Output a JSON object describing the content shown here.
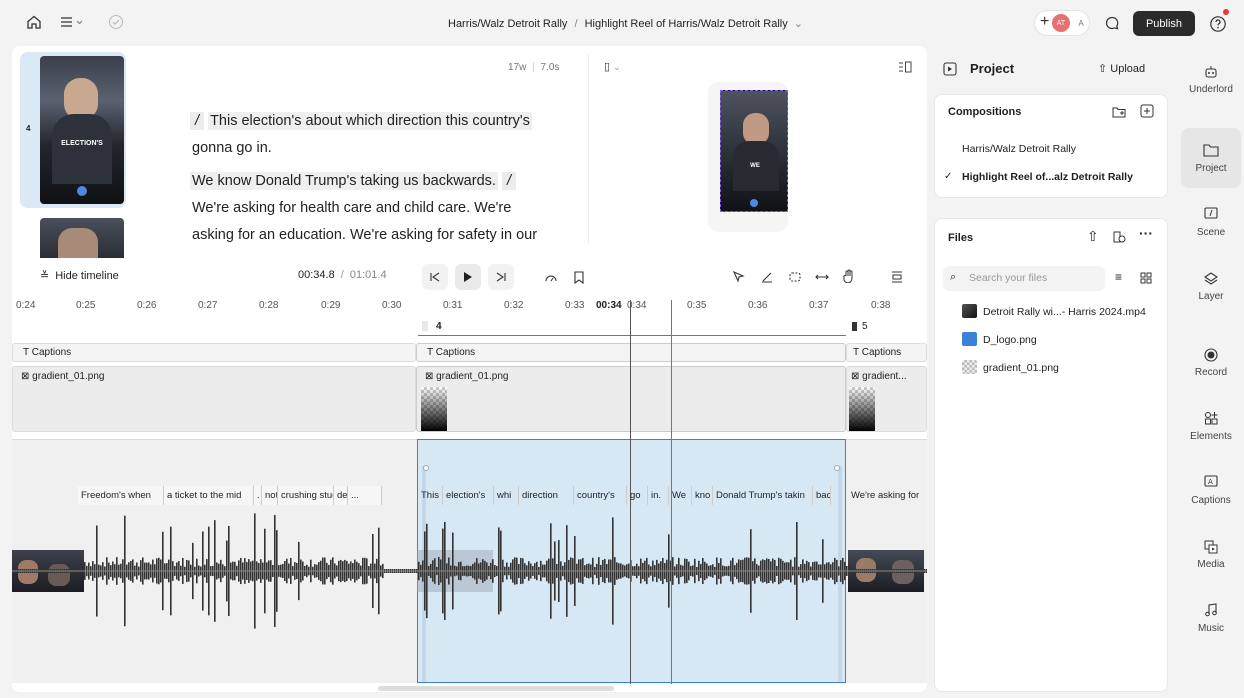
{
  "topbar": {
    "breadcrumb_project": "Harris/Walz Detroit Rally",
    "breadcrumb_sep": "/",
    "breadcrumb_comp": "Highlight Reel of Harris/Walz Detroit Rally",
    "avatar_initials": "AT",
    "avatar_a": "A",
    "publish_label": "Publish"
  },
  "script": {
    "word_count": "17w",
    "duration": "7.0s",
    "scene_number": "4",
    "thumb_caption": "ELECTION'S",
    "preview_caption": "WE",
    "paragraph1_marker": "/",
    "paragraph1_line1": "This election's about which direction this country's",
    "paragraph1_line2": "gonna go in.",
    "paragraph2_line1": "We know Donald Trump's taking us backwards.",
    "paragraph2_marker": "/",
    "paragraph2_line2": "We're asking for health care and child care. We're",
    "paragraph2_line3": "asking for an education. We're asking for safety in our"
  },
  "transport": {
    "hide_timeline": "Hide timeline",
    "current_time": "00:34.8",
    "separator": "/",
    "total_time": "01:01.4"
  },
  "timeline": {
    "ticks": [
      {
        "label": "0:24"
      },
      {
        "label": "0:25"
      },
      {
        "label": "0:26"
      },
      {
        "label": "0:27"
      },
      {
        "label": "0:28"
      },
      {
        "label": "0:29"
      },
      {
        "label": "0:30"
      },
      {
        "label": "0:31"
      },
      {
        "label": "0:32"
      },
      {
        "label": "0:33"
      },
      {
        "label": "0:34"
      },
      {
        "label": "0:35"
      },
      {
        "label": "0:36"
      },
      {
        "label": "0:37"
      },
      {
        "label": "0:38"
      }
    ],
    "playhead_label": "00:34",
    "scene4_label": "4",
    "scene5_label": "5",
    "captions_label": "Captions",
    "gradient_label": "gradient_01.png",
    "gradient_trunc": "gradient...",
    "words_left": [
      "Freedom's when",
      "a ticket to the mid",
      ".",
      "not",
      "crushing stud",
      "de",
      "..."
    ],
    "words_mid": [
      "This",
      "election's",
      "whi",
      "direction",
      "country's",
      "go",
      "in.",
      "We",
      "kno",
      "Donald Trump's takin",
      "bac"
    ],
    "words_right": "We're asking for"
  },
  "project_panel": {
    "title": "Project",
    "upload": "Upload",
    "compositions_title": "Compositions",
    "compositions": [
      {
        "name": "Harris/Walz Detroit Rally",
        "selected": false
      },
      {
        "name": "Highlight Reel of...alz Detroit Rally",
        "selected": true
      }
    ],
    "files_title": "Files",
    "search_placeholder": "Search your files",
    "files": [
      {
        "name": "Detroit Rally wi...- Harris 2024.mp4",
        "icon": "video-icon"
      },
      {
        "name": "D_logo.png",
        "icon": "image-icon"
      },
      {
        "name": "gradient_01.png",
        "icon": "image-icon"
      }
    ]
  },
  "rightnav": [
    {
      "label": "Underlord",
      "icon": "robot-icon"
    },
    {
      "label": "Project",
      "icon": "folder-icon"
    },
    {
      "label": "Scene",
      "icon": "scene-icon"
    },
    {
      "label": "Layer",
      "icon": "layers-icon"
    },
    {
      "label": "Record",
      "icon": "record-icon"
    },
    {
      "label": "Elements",
      "icon": "elements-icon"
    },
    {
      "label": "Captions",
      "icon": "captions-icon"
    },
    {
      "label": "Media",
      "icon": "media-icon"
    },
    {
      "label": "Music",
      "icon": "music-icon"
    }
  ],
  "colors": {
    "accent": "#3b82d6",
    "selection": "#d7e8f5",
    "dark_button": "#2b2b2b",
    "notif": "#e33"
  }
}
